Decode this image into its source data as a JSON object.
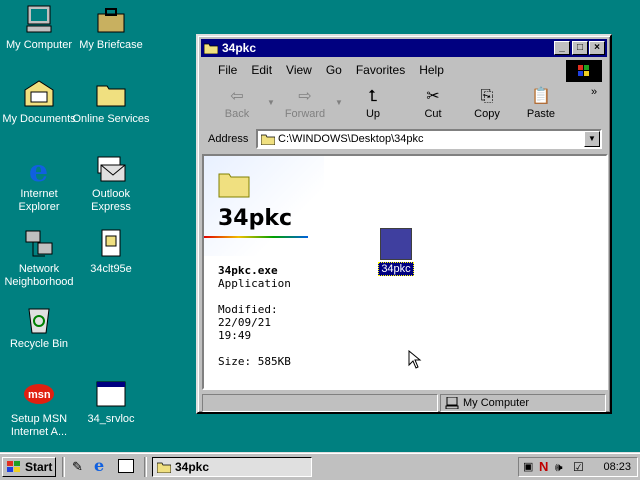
{
  "desktop": {
    "icons": [
      {
        "label": "My Computer"
      },
      {
        "label": "My Briefcase"
      },
      {
        "label": "My Documents"
      },
      {
        "label": "Online Services"
      },
      {
        "label": "Internet Explorer"
      },
      {
        "label": "Outlook Express"
      },
      {
        "label": "Network Neighborhood"
      },
      {
        "label": "34clt95e"
      },
      {
        "label": "Recycle Bin"
      },
      {
        "label": "Setup MSN Internet A..."
      },
      {
        "label": "34_srvloc"
      }
    ]
  },
  "window": {
    "title": "34pkc",
    "menu": [
      "File",
      "Edit",
      "View",
      "Go",
      "Favorites",
      "Help"
    ],
    "toolbar": {
      "back": "Back",
      "forward": "Forward",
      "up": "Up",
      "cut": "Cut",
      "copy": "Copy",
      "paste": "Paste"
    },
    "address": {
      "label": "Address",
      "value": "C:\\WINDOWS\\Desktop\\34pkc"
    },
    "webview": {
      "folder_title": "34pkc",
      "file_name": "34pkc.exe",
      "file_type": "Application",
      "modified_label": "Modified:",
      "modified_date": "22/09/21",
      "modified_time": "19:49",
      "size": "Size: 585KB"
    },
    "file_item_label": "34pkc",
    "status": {
      "zone": "My Computer"
    }
  },
  "taskbar": {
    "start": "Start",
    "task": "34pkc",
    "clock": "08:23"
  },
  "colors": {
    "desktop": "#008080",
    "titlebar": "#000080",
    "face": "#c0c0c0"
  }
}
